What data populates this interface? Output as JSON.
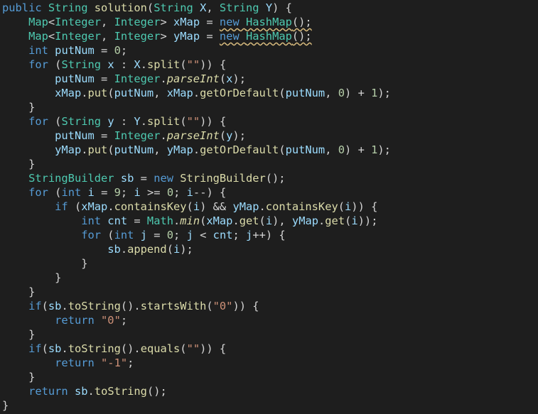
{
  "colors": {
    "background": "#1e1e1e",
    "kw": "#569cd6",
    "ty": "#4ec9b0",
    "fn": "#dcdcaa",
    "var": "#9cdcfe",
    "str": "#ce9178",
    "num": "#b5cea8",
    "op": "#d4d4d4"
  },
  "editor": {
    "lines": [
      [
        [
          "kw",
          "public"
        ],
        [
          "op",
          " "
        ],
        [
          "ty",
          "String"
        ],
        [
          "op",
          " "
        ],
        [
          "fn",
          "solution"
        ],
        [
          "op",
          "("
        ],
        [
          "ty",
          "String"
        ],
        [
          "op",
          " "
        ],
        [
          "var",
          "X"
        ],
        [
          "op",
          ", "
        ],
        [
          "ty",
          "String"
        ],
        [
          "op",
          " "
        ],
        [
          "var",
          "Y"
        ],
        [
          "op",
          ") {"
        ]
      ],
      [
        [
          "op",
          "    "
        ],
        [
          "ty",
          "Map"
        ],
        [
          "op",
          "<"
        ],
        [
          "ty",
          "Integer"
        ],
        [
          "op",
          ", "
        ],
        [
          "ty",
          "Integer"
        ],
        [
          "op",
          "> "
        ],
        [
          "var",
          "xMap"
        ],
        [
          "op",
          " = "
        ],
        [
          "kw",
          "new"
        ],
        [
          "op",
          " "
        ],
        [
          "ty",
          "HashMap"
        ],
        [
          "op",
          "();"
        ]
      ],
      [
        [
          "op",
          "    "
        ],
        [
          "ty",
          "Map"
        ],
        [
          "op",
          "<"
        ],
        [
          "ty",
          "Integer"
        ],
        [
          "op",
          ", "
        ],
        [
          "ty",
          "Integer"
        ],
        [
          "op",
          "> "
        ],
        [
          "var",
          "yMap"
        ],
        [
          "op",
          " = "
        ],
        [
          "kw",
          "new"
        ],
        [
          "op",
          " "
        ],
        [
          "ty",
          "HashMap"
        ],
        [
          "op",
          "();"
        ]
      ],
      [
        [
          "op",
          "    "
        ],
        [
          "kw",
          "int"
        ],
        [
          "op",
          " "
        ],
        [
          "var",
          "putNum"
        ],
        [
          "op",
          " = "
        ],
        [
          "num",
          "0"
        ],
        [
          "op",
          ";"
        ]
      ],
      [
        [
          "op",
          "    "
        ],
        [
          "kw",
          "for"
        ],
        [
          "op",
          " ("
        ],
        [
          "ty",
          "String"
        ],
        [
          "op",
          " "
        ],
        [
          "var",
          "x"
        ],
        [
          "op",
          " : "
        ],
        [
          "var",
          "X"
        ],
        [
          "op",
          "."
        ],
        [
          "fn",
          "split"
        ],
        [
          "op",
          "("
        ],
        [
          "str",
          "\"\""
        ],
        [
          "op",
          ")) {"
        ]
      ],
      [
        [
          "op",
          "        "
        ],
        [
          "var",
          "putNum"
        ],
        [
          "op",
          " = "
        ],
        [
          "ty",
          "Integer"
        ],
        [
          "op",
          "."
        ],
        [
          "it",
          "parseInt"
        ],
        [
          "op",
          "("
        ],
        [
          "var",
          "x"
        ],
        [
          "op",
          ");"
        ]
      ],
      [
        [
          "op",
          "        "
        ],
        [
          "var",
          "xMap"
        ],
        [
          "op",
          "."
        ],
        [
          "fn",
          "put"
        ],
        [
          "op",
          "("
        ],
        [
          "var",
          "putNum"
        ],
        [
          "op",
          ", "
        ],
        [
          "var",
          "xMap"
        ],
        [
          "op",
          "."
        ],
        [
          "fn",
          "getOrDefault"
        ],
        [
          "op",
          "("
        ],
        [
          "var",
          "putNum"
        ],
        [
          "op",
          ", "
        ],
        [
          "num",
          "0"
        ],
        [
          "op",
          ") + "
        ],
        [
          "num",
          "1"
        ],
        [
          "op",
          ");"
        ]
      ],
      [
        [
          "op",
          "    }"
        ]
      ],
      [
        [
          "op",
          "    "
        ],
        [
          "kw",
          "for"
        ],
        [
          "op",
          " ("
        ],
        [
          "ty",
          "String"
        ],
        [
          "op",
          " "
        ],
        [
          "var",
          "y"
        ],
        [
          "op",
          " : "
        ],
        [
          "var",
          "Y"
        ],
        [
          "op",
          "."
        ],
        [
          "fn",
          "split"
        ],
        [
          "op",
          "("
        ],
        [
          "str",
          "\"\""
        ],
        [
          "op",
          ")) {"
        ]
      ],
      [
        [
          "op",
          "        "
        ],
        [
          "var",
          "putNum"
        ],
        [
          "op",
          " = "
        ],
        [
          "ty",
          "Integer"
        ],
        [
          "op",
          "."
        ],
        [
          "it",
          "parseInt"
        ],
        [
          "op",
          "("
        ],
        [
          "var",
          "y"
        ],
        [
          "op",
          ");"
        ]
      ],
      [
        [
          "op",
          "        "
        ],
        [
          "var",
          "yMap"
        ],
        [
          "op",
          "."
        ],
        [
          "fn",
          "put"
        ],
        [
          "op",
          "("
        ],
        [
          "var",
          "putNum"
        ],
        [
          "op",
          ", "
        ],
        [
          "var",
          "yMap"
        ],
        [
          "op",
          "."
        ],
        [
          "fn",
          "getOrDefault"
        ],
        [
          "op",
          "("
        ],
        [
          "var",
          "putNum"
        ],
        [
          "op",
          ", "
        ],
        [
          "num",
          "0"
        ],
        [
          "op",
          ") + "
        ],
        [
          "num",
          "1"
        ],
        [
          "op",
          ");"
        ]
      ],
      [
        [
          "op",
          "    }"
        ]
      ],
      [
        [
          "op",
          "    "
        ],
        [
          "ty",
          "StringBuilder"
        ],
        [
          "op",
          " "
        ],
        [
          "var",
          "sb"
        ],
        [
          "op",
          " = "
        ],
        [
          "kw",
          "new"
        ],
        [
          "op",
          " "
        ],
        [
          "fn",
          "StringBuilder"
        ],
        [
          "op",
          "();"
        ]
      ],
      [
        [
          "op",
          "    "
        ],
        [
          "kw",
          "for"
        ],
        [
          "op",
          " ("
        ],
        [
          "kw",
          "int"
        ],
        [
          "op",
          " "
        ],
        [
          "var",
          "i"
        ],
        [
          "op",
          " = "
        ],
        [
          "num",
          "9"
        ],
        [
          "op",
          "; "
        ],
        [
          "var",
          "i"
        ],
        [
          "op",
          " >= "
        ],
        [
          "num",
          "0"
        ],
        [
          "op",
          "; "
        ],
        [
          "var",
          "i"
        ],
        [
          "op",
          "--) {"
        ]
      ],
      [
        [
          "op",
          "        "
        ],
        [
          "kw",
          "if"
        ],
        [
          "op",
          " ("
        ],
        [
          "var",
          "xMap"
        ],
        [
          "op",
          "."
        ],
        [
          "fn",
          "containsKey"
        ],
        [
          "op",
          "("
        ],
        [
          "var",
          "i"
        ],
        [
          "op",
          ") && "
        ],
        [
          "var",
          "yMap"
        ],
        [
          "op",
          "."
        ],
        [
          "fn",
          "containsKey"
        ],
        [
          "op",
          "("
        ],
        [
          "var",
          "i"
        ],
        [
          "op",
          ")) {"
        ]
      ],
      [
        [
          "op",
          "            "
        ],
        [
          "kw",
          "int"
        ],
        [
          "op",
          " "
        ],
        [
          "var",
          "cnt"
        ],
        [
          "op",
          " = "
        ],
        [
          "ty",
          "Math"
        ],
        [
          "op",
          "."
        ],
        [
          "it",
          "min"
        ],
        [
          "op",
          "("
        ],
        [
          "var",
          "xMap"
        ],
        [
          "op",
          "."
        ],
        [
          "fn",
          "get"
        ],
        [
          "op",
          "("
        ],
        [
          "var",
          "i"
        ],
        [
          "op",
          "), "
        ],
        [
          "var",
          "yMap"
        ],
        [
          "op",
          "."
        ],
        [
          "fn",
          "get"
        ],
        [
          "op",
          "("
        ],
        [
          "var",
          "i"
        ],
        [
          "op",
          "));"
        ]
      ],
      [
        [
          "op",
          "            "
        ],
        [
          "kw",
          "for"
        ],
        [
          "op",
          " ("
        ],
        [
          "kw",
          "int"
        ],
        [
          "op",
          " "
        ],
        [
          "var",
          "j"
        ],
        [
          "op",
          " = "
        ],
        [
          "num",
          "0"
        ],
        [
          "op",
          "; "
        ],
        [
          "var",
          "j"
        ],
        [
          "op",
          " < "
        ],
        [
          "var",
          "cnt"
        ],
        [
          "op",
          "; "
        ],
        [
          "var",
          "j"
        ],
        [
          "op",
          "++) {"
        ]
      ],
      [
        [
          "op",
          "                "
        ],
        [
          "var",
          "sb"
        ],
        [
          "op",
          "."
        ],
        [
          "fn",
          "append"
        ],
        [
          "op",
          "("
        ],
        [
          "var",
          "i"
        ],
        [
          "op",
          ");"
        ]
      ],
      [
        [
          "op",
          "            }"
        ]
      ],
      [
        [
          "op",
          "        }"
        ]
      ],
      [
        [
          "op",
          "    }"
        ]
      ],
      [
        [
          "op",
          "    "
        ],
        [
          "kw",
          "if"
        ],
        [
          "op",
          "("
        ],
        [
          "var",
          "sb"
        ],
        [
          "op",
          "."
        ],
        [
          "fn",
          "toString"
        ],
        [
          "op",
          "()."
        ],
        [
          "fn",
          "startsWith"
        ],
        [
          "op",
          "("
        ],
        [
          "str",
          "\"0\""
        ],
        [
          "op",
          ")) {"
        ]
      ],
      [
        [
          "op",
          "        "
        ],
        [
          "kw",
          "return"
        ],
        [
          "op",
          " "
        ],
        [
          "str",
          "\"0\""
        ],
        [
          "op",
          ";"
        ]
      ],
      [
        [
          "op",
          "    }"
        ]
      ],
      [
        [
          "op",
          "    "
        ],
        [
          "kw",
          "if"
        ],
        [
          "op",
          "("
        ],
        [
          "var",
          "sb"
        ],
        [
          "op",
          "."
        ],
        [
          "fn",
          "toString"
        ],
        [
          "op",
          "()."
        ],
        [
          "fn",
          "equals"
        ],
        [
          "op",
          "("
        ],
        [
          "str",
          "\"\""
        ],
        [
          "op",
          ")) {"
        ]
      ],
      [
        [
          "op",
          "        "
        ],
        [
          "kw",
          "return"
        ],
        [
          "op",
          " "
        ],
        [
          "str",
          "\"-1\""
        ],
        [
          "op",
          ";"
        ]
      ],
      [
        [
          "op",
          "    }"
        ]
      ],
      [
        [
          "op",
          "    "
        ],
        [
          "kw",
          "return"
        ],
        [
          "op",
          " "
        ],
        [
          "var",
          "sb"
        ],
        [
          "op",
          "."
        ],
        [
          "fn",
          "toString"
        ],
        [
          "op",
          "();"
        ]
      ],
      [
        [
          "op",
          "}"
        ]
      ]
    ]
  }
}
